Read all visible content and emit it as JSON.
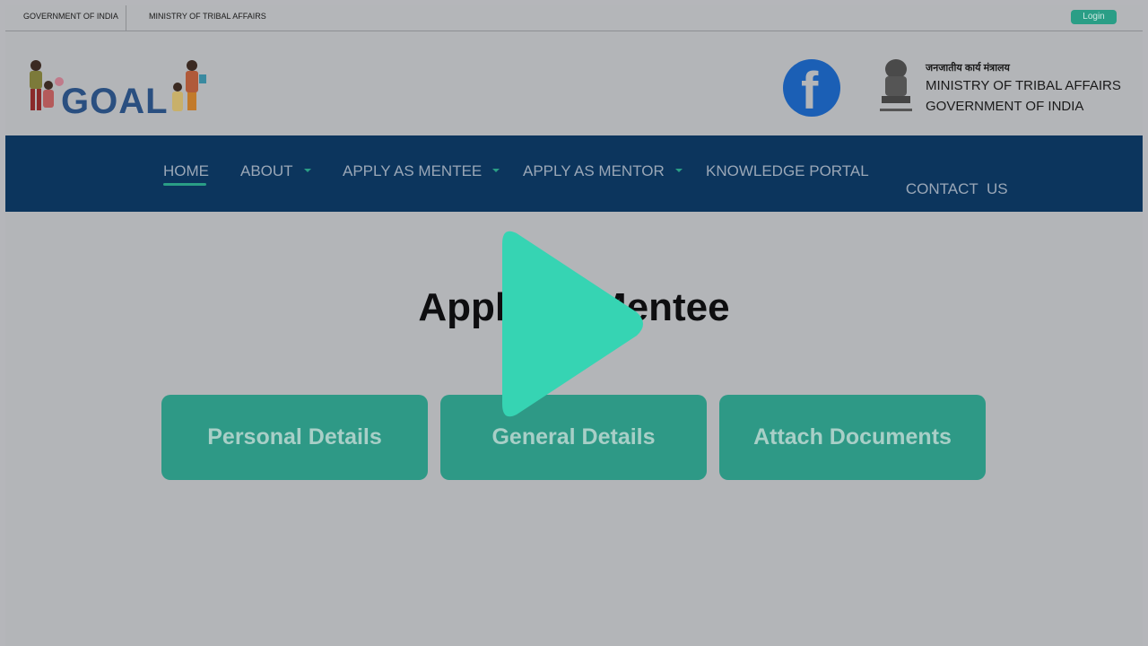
{
  "topbar": {
    "government": "GOVERNMENT OF INDIA",
    "ministry": "MINISTRY OF TRIBAL AFFAIRS",
    "login_label": "Login"
  },
  "header": {
    "logo_text": "GOAL",
    "ministry_hindi": "जनजातीय कार्य मंत्रालय",
    "ministry_line1": "MINISTRY OF TRIBAL AFFAIRS",
    "ministry_line2": "GOVERNMENT OF INDIA",
    "facebook_icon": "facebook-icon"
  },
  "nav": {
    "items": [
      {
        "label": "HOME",
        "active": true
      },
      {
        "label": "ABOUT",
        "dropdown": true
      },
      {
        "label": "APPLY AS MENTEE",
        "dropdown": true
      },
      {
        "label": "APPLY AS MENTOR",
        "dropdown": true
      },
      {
        "label": "KNOWLEDGE PORTAL"
      },
      {
        "label": "CONTACT  US"
      }
    ]
  },
  "main": {
    "title": "Apply as Mentee",
    "steps": [
      "Personal Details",
      "General Details",
      "Attach Documents"
    ]
  },
  "overlay": {
    "icon": "play-icon",
    "color": "#36d4b3"
  },
  "colors": {
    "nav_bg": "#0c355d",
    "accent": "#2a9e86",
    "step_bg": "#2e9986"
  }
}
